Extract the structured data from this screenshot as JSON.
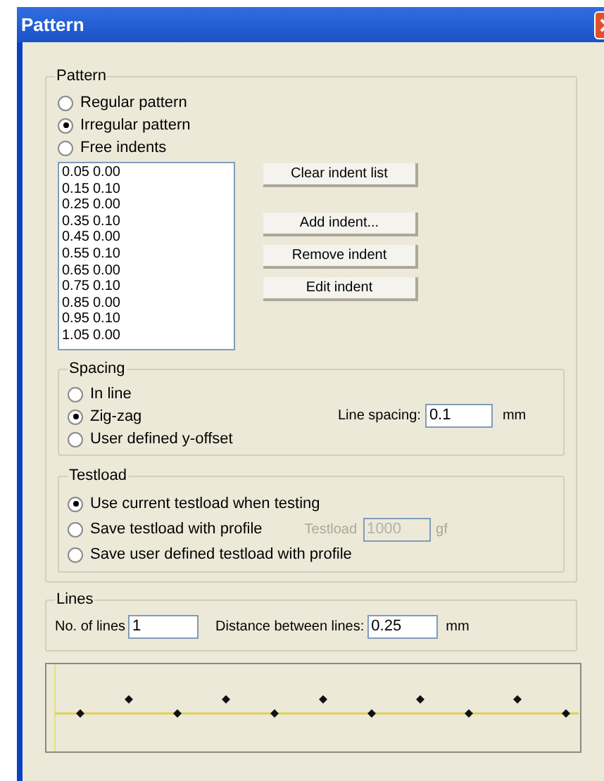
{
  "window": {
    "title": "Pattern"
  },
  "pattern": {
    "title": "Pattern",
    "options": [
      {
        "label": "Regular pattern",
        "selected": false
      },
      {
        "label": "Irregular pattern",
        "selected": true
      },
      {
        "label": "Free indents",
        "selected": false
      }
    ],
    "indents": [
      [
        "0.05",
        "0.00"
      ],
      [
        "0.15",
        "0.10"
      ],
      [
        "0.25",
        "0.00"
      ],
      [
        "0.35",
        "0.10"
      ],
      [
        "0.45",
        "0.00"
      ],
      [
        "0.55",
        "0.10"
      ],
      [
        "0.65",
        "0.00"
      ],
      [
        "0.75",
        "0.10"
      ],
      [
        "0.85",
        "0.00"
      ],
      [
        "0.95",
        "0.10"
      ],
      [
        "1.05",
        "0.00"
      ]
    ],
    "buttons": [
      "Clear indent list",
      "Add indent...",
      "Remove indent",
      "Edit indent"
    ]
  },
  "spacing": {
    "title": "Spacing",
    "options": [
      {
        "label": "In line",
        "selected": false
      },
      {
        "label": "Zig-zag",
        "selected": true
      },
      {
        "label": "User defined y-offset",
        "selected": false
      }
    ],
    "line_spacing": {
      "label": "Line spacing:",
      "value": "0.1",
      "unit": "mm"
    }
  },
  "testload": {
    "title": "Testload",
    "options": [
      {
        "label": "Use current testload when testing",
        "selected": true
      },
      {
        "label": "Save testload with profile",
        "selected": false
      },
      {
        "label": "Save user defined testload with profile",
        "selected": false
      }
    ],
    "field": {
      "label": "Testload",
      "value": "1000",
      "unit": "gf",
      "disabled": true
    }
  },
  "lines": {
    "title": "Lines",
    "count": {
      "label": "No. of lines",
      "value": "1"
    },
    "distance": {
      "label": "Distance between lines:",
      "value": "0.25",
      "unit": "mm"
    }
  }
}
